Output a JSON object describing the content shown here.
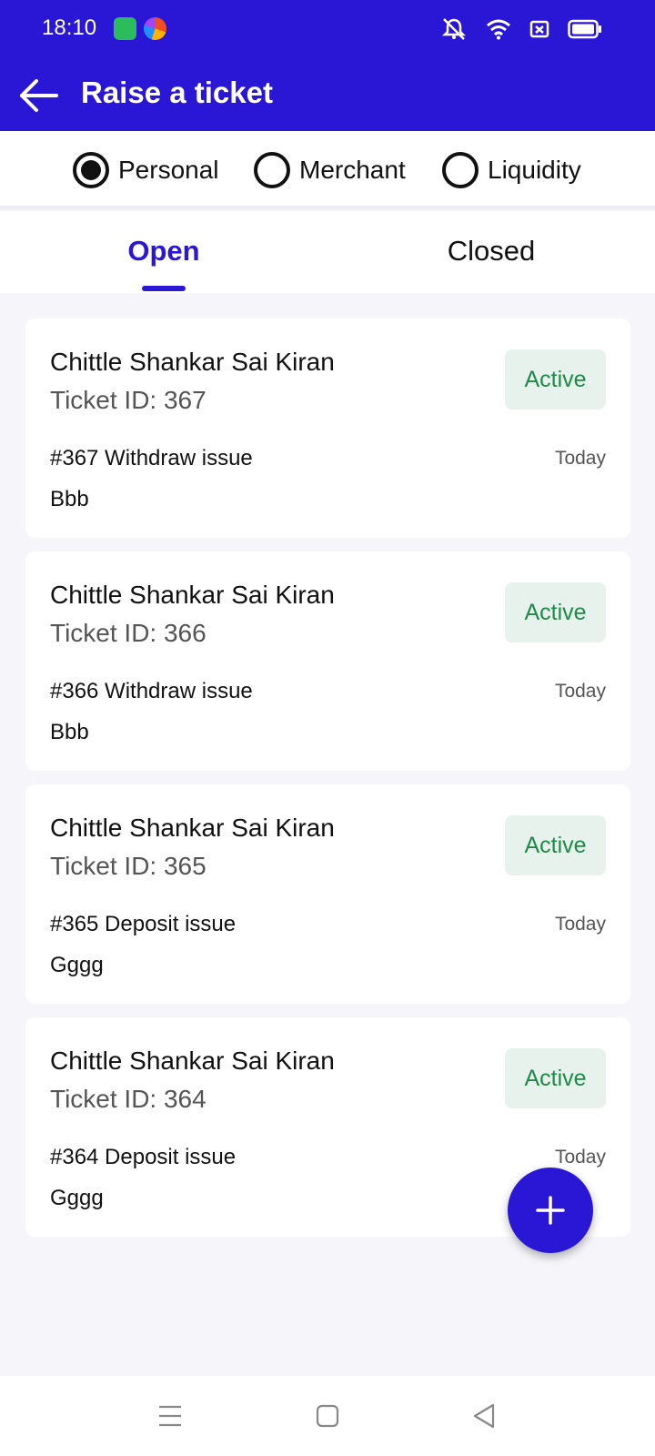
{
  "status_bar": {
    "time": "18:10",
    "icons": [
      "green-app-icon",
      "browser-icon",
      "mute-icon",
      "wifi-icon",
      "sim-icon",
      "battery-icon"
    ]
  },
  "app_bar": {
    "title": "Raise a ticket",
    "back_icon": "back-arrow-icon",
    "color": "#2a17d6"
  },
  "account_types": {
    "options": [
      "Personal",
      "Merchant",
      "Liquidity"
    ],
    "selected": "Personal"
  },
  "tabs": {
    "items": [
      "Open",
      "Closed"
    ],
    "active": "Open"
  },
  "tickets": [
    {
      "name": "Chittle Shankar Sai Kiran",
      "ticket_id": "Ticket ID: 367",
      "status": "Active",
      "subject": "#367 Withdraw issue",
      "date": "Today",
      "description": "Bbb"
    },
    {
      "name": "Chittle Shankar Sai Kiran",
      "ticket_id": "Ticket ID: 366",
      "status": "Active",
      "subject": "#366 Withdraw issue",
      "date": "Today",
      "description": "Bbb"
    },
    {
      "name": "Chittle Shankar Sai Kiran",
      "ticket_id": "Ticket ID: 365",
      "status": "Active",
      "subject": "#365 Deposit issue",
      "date": "Today",
      "description": "Gggg"
    },
    {
      "name": "Chittle Shankar Sai Kiran",
      "ticket_id": "Ticket ID: 364",
      "status": "Active",
      "subject": "#364 Deposit issue",
      "date": "Today",
      "description": "Gggg"
    }
  ],
  "fab": {
    "icon": "plus-icon"
  },
  "nav_bar": {
    "icons": [
      "menu-icon",
      "home-icon",
      "back-icon"
    ]
  },
  "colors": {
    "accent": "#2a17d6",
    "active_badge_bg": "#e8f2ec",
    "active_badge_text": "#1f8a4c"
  }
}
